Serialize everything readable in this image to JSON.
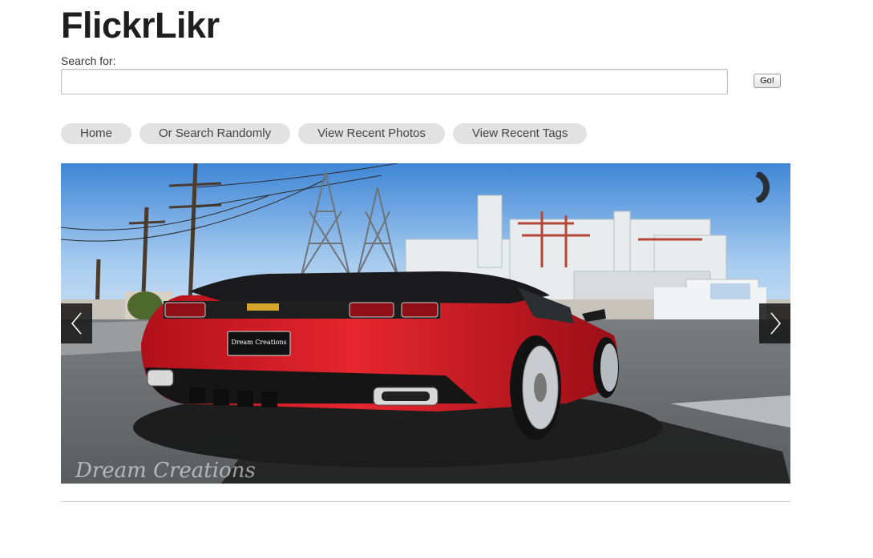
{
  "app": {
    "title": "FlickrLikr"
  },
  "search": {
    "label": "Search for:",
    "value": "",
    "placeholder": "",
    "button_label": "Go!"
  },
  "nav": {
    "items": [
      {
        "label": "Home"
      },
      {
        "label": "Or Search Randomly"
      },
      {
        "label": "View Recent Photos"
      },
      {
        "label": "View Recent Tags"
      }
    ]
  },
  "slider": {
    "photo_subject": "red car parked near industrial plant",
    "watermark": "Dream Creations",
    "plate_text": "Dream Creations",
    "prev_icon": "chevron-left-icon",
    "next_icon": "chevron-right-icon",
    "loader_icon": "loading-spinner-icon"
  },
  "colors": {
    "nav_pill_bg": "#e2e2e2",
    "arrow_bg": "#141414",
    "car_red": "#d8202a"
  }
}
